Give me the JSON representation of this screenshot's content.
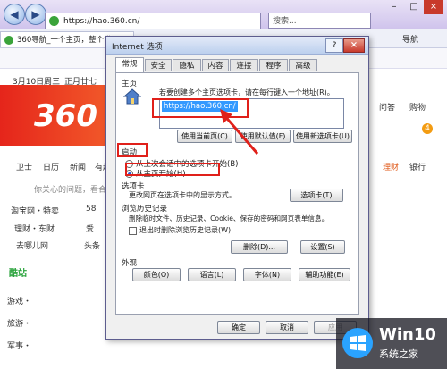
{
  "browser": {
    "address": "https://hao.360.cn/",
    "search_placeholder": "搜索...",
    "tab_title": "360导航_一个主页，整个世界",
    "toolbar_right": "导航"
  },
  "page": {
    "date": "3月10日周三",
    "lunar": "正月廿七",
    "nav": [
      "卫士",
      "日历",
      "新闻",
      "有趣"
    ],
    "notice": "你关心的问题，看合",
    "links": [
      {
        "a": "淘宝网・特卖",
        "b": "58"
      },
      {
        "a": "理财・东财",
        "b": "爱"
      },
      {
        "a": "去哪儿网",
        "b": "头条"
      }
    ],
    "section_head": "酷站",
    "sites": [
      "游戏・",
      "旅游・",
      "军事・"
    ],
    "right_items": [
      "问答",
      "购物",
      "理财",
      "银行"
    ],
    "badge": "4"
  },
  "dialog": {
    "title": "Internet 选项",
    "help": "?",
    "close": "×",
    "tabs": [
      "常规",
      "安全",
      "隐私",
      "内容",
      "连接",
      "程序",
      "高级"
    ],
    "home": {
      "label": "主页",
      "desc": "若要创建多个主页选项卡，请在每行键入一个地址(R)。",
      "url": "https://hao.360.cn/",
      "btn_current": "使用当前页(C)",
      "btn_default": "使用默认值(F)",
      "btn_newtab": "使用新选项卡(U)"
    },
    "startup": {
      "label": "启动",
      "opt_last": "从上次会话中的选项卡开始(B)",
      "opt_home": "从主页开始(H)"
    },
    "tabs_section": {
      "label": "选项卡",
      "desc": "更改网页在选项卡中的显示方式。",
      "btn": "选项卡(T)"
    },
    "history": {
      "label": "浏览历史记录",
      "desc": "删除临时文件、历史记录、Cookie、保存的密码和网页表单信息。",
      "chk": "退出时删除浏览历史记录(W)",
      "btn_delete": "删除(D)...",
      "btn_settings": "设置(S)"
    },
    "appearance": {
      "label": "外观",
      "btn_colors": "颜色(O)",
      "btn_lang": "语言(L)",
      "btn_fonts": "字体(N)",
      "btn_access": "辅助功能(E)"
    },
    "ok": "确定",
    "cancel": "取消",
    "apply": "应用"
  },
  "watermark": {
    "brand": "Win10",
    "subtitle": "系统之家"
  }
}
